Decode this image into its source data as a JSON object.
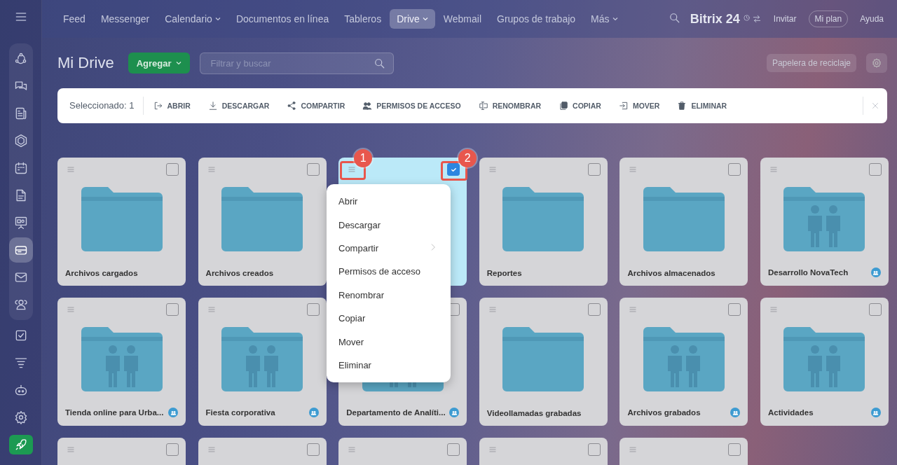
{
  "top_nav": {
    "items": [
      {
        "label": "Feed",
        "dropdown": false,
        "selected": false
      },
      {
        "label": "Messenger",
        "dropdown": false,
        "selected": false
      },
      {
        "label": "Calendario",
        "dropdown": true,
        "selected": false
      },
      {
        "label": "Documentos en línea",
        "dropdown": false,
        "selected": false
      },
      {
        "label": "Tableros",
        "dropdown": false,
        "selected": false
      },
      {
        "label": "Drive",
        "dropdown": true,
        "selected": true
      },
      {
        "label": "Webmail",
        "dropdown": false,
        "selected": false
      },
      {
        "label": "Grupos de trabajo",
        "dropdown": false,
        "selected": false
      },
      {
        "label": "Más",
        "dropdown": true,
        "selected": false
      }
    ],
    "logo": "Bitrix 24",
    "buttons": [
      "Invitar",
      "Mi plan",
      "Ayuda"
    ]
  },
  "sidebar": {
    "pinned_items": [
      {
        "kind": "stream",
        "selected": false
      },
      {
        "kind": "chat",
        "selected": false
      },
      {
        "kind": "news",
        "selected": false
      },
      {
        "kind": "hexagon",
        "selected": false
      },
      {
        "kind": "calendar",
        "selected": false
      },
      {
        "kind": "document",
        "selected": false
      },
      {
        "kind": "board",
        "selected": false
      },
      {
        "kind": "drive",
        "selected": true
      },
      {
        "kind": "mail",
        "selected": false
      },
      {
        "kind": "people",
        "selected": false
      }
    ],
    "other_items": [
      {
        "kind": "tasks",
        "selected": false
      },
      {
        "kind": "funnel",
        "selected": false
      },
      {
        "kind": "robot",
        "selected": false
      },
      {
        "kind": "settings",
        "selected": false
      },
      {
        "kind": "rocket",
        "selected": false
      }
    ]
  },
  "page_title": "Mi Drive",
  "add_button": "Agregar",
  "search": {
    "placeholder": "Filtrar y buscar"
  },
  "recycle_button": "Papelera de reciclaje",
  "action_bar": {
    "selected_count": "Seleccionado: 1",
    "actions": [
      {
        "kind": "open",
        "label": "ABRIR"
      },
      {
        "kind": "download",
        "label": "DESCARGAR"
      },
      {
        "kind": "share",
        "label": "COMPARTIR"
      },
      {
        "kind": "access",
        "label": "PERMISOS DE ACCESO"
      },
      {
        "kind": "rename",
        "label": "RENOMBRAR"
      },
      {
        "kind": "copy",
        "label": "COPIAR"
      },
      {
        "kind": "move",
        "label": "MOVER"
      },
      {
        "kind": "delete",
        "label": "ELIMINAR"
      }
    ]
  },
  "cards": [
    {
      "kind": "folder",
      "name": "Archivos cargados",
      "shared": false,
      "selected": false
    },
    {
      "kind": "folder",
      "name": "Archivos creados",
      "shared": false,
      "selected": false
    },
    {
      "kind": "covered",
      "selected": true
    },
    {
      "kind": "folder",
      "name": "Reportes",
      "shared": false,
      "selected": false
    },
    {
      "kind": "folder",
      "name": "Archivos almacenados",
      "shared": false,
      "selected": false
    },
    {
      "kind": "group",
      "name": "Desarrollo NovaTech",
      "shared": true,
      "selected": false
    },
    {
      "kind": "group",
      "name": "Tienda online para Urba...",
      "shared": true,
      "selected": false
    },
    {
      "kind": "group",
      "name": "Fiesta corporativa",
      "shared": true,
      "selected": false
    },
    {
      "kind": "group",
      "name": "Departamento de Analíti...",
      "shared": true,
      "selected": false
    },
    {
      "kind": "folder",
      "name": "Videollamadas grabadas",
      "shared": false,
      "selected": false
    },
    {
      "kind": "group",
      "name": "Archivos grabados",
      "shared": true,
      "selected": false
    },
    {
      "kind": "group",
      "name": "Actividades",
      "shared": true,
      "selected": false
    },
    {
      "kind": "partial",
      "selected": false
    },
    {
      "kind": "partial",
      "selected": false
    },
    {
      "kind": "partial",
      "selected": false
    },
    {
      "kind": "partial",
      "selected": false
    },
    {
      "kind": "partial",
      "selected": false
    }
  ],
  "context_menu": {
    "items": [
      {
        "label": "Abrir",
        "submenu": false
      },
      {
        "label": "Descargar",
        "submenu": false
      },
      {
        "label": "Compartir",
        "submenu": true
      },
      {
        "label": "Permisos de acceso",
        "submenu": false
      },
      {
        "label": "Renombrar",
        "submenu": false
      },
      {
        "label": "Copiar",
        "submenu": false
      },
      {
        "label": "Mover",
        "submenu": false
      },
      {
        "label": "Eliminar",
        "submenu": false
      }
    ]
  },
  "callouts": [
    "1",
    "2"
  ]
}
